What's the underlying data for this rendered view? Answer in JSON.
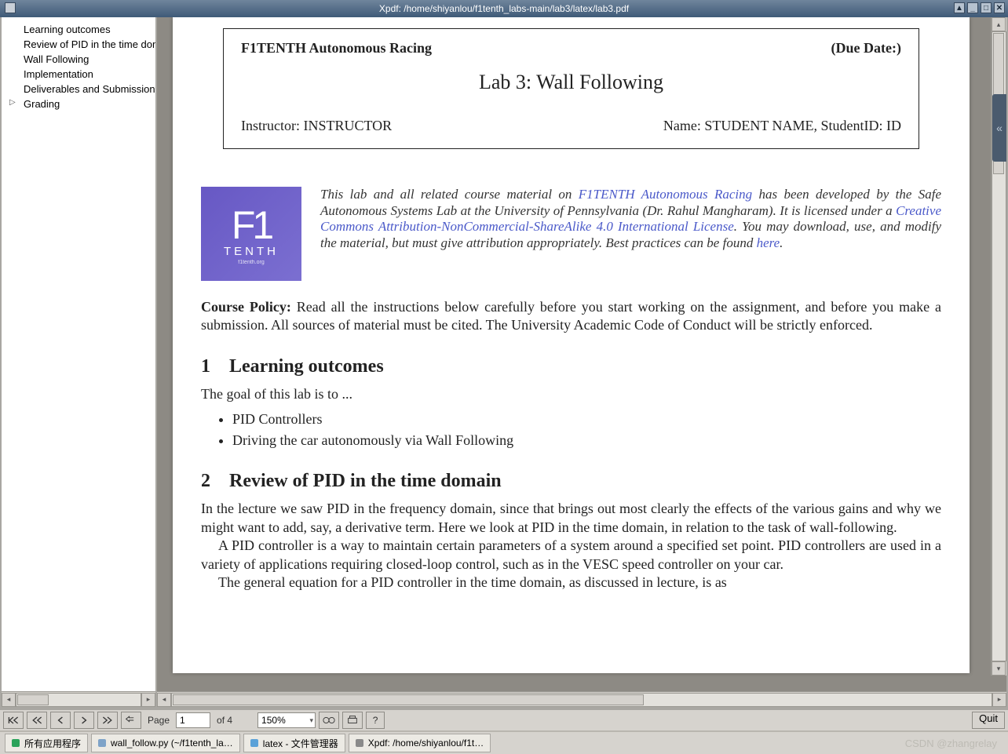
{
  "window": {
    "title": "Xpdf: /home/shiyanlou/f1tenth_labs-main/lab3/latex/lab3.pdf"
  },
  "outline": {
    "items": [
      {
        "label": "Learning outcomes",
        "arrow": false
      },
      {
        "label": "Review of PID in the time domain",
        "arrow": false
      },
      {
        "label": "Wall Following",
        "arrow": false
      },
      {
        "label": "Implementation",
        "arrow": false
      },
      {
        "label": "Deliverables and Submission",
        "arrow": false
      },
      {
        "label": "Grading",
        "arrow": true
      }
    ]
  },
  "doc": {
    "header_left": "F1TENTH Autonomous Racing",
    "header_right": "(Due Date:)",
    "title": "Lab 3: Wall Following",
    "instructor_label": "Instructor:",
    "instructor": "INSTRUCTOR",
    "name_label": "Name:",
    "name": "STUDENT NAME",
    "studentid_label": "StudentID:",
    "studentid": "ID",
    "logo_top": "F1",
    "logo_mid": "TENTH",
    "logo_sub": "f1tenth.org",
    "license_pre": "This lab and all related course material on ",
    "license_link1": "F1TENTH Autonomous Racing",
    "license_mid1": " has been developed by the Safe Autonomous Systems Lab at the University of Pennsylvania (Dr. Rahul Mangharam). It is licensed under a ",
    "license_link2": "Creative Commons Attribution-NonCommercial-ShareAlike 4.0 International License",
    "license_mid2": ". You may download, use, and modify the material, but must give attribution appropriately. Best practices can be found ",
    "license_here": "here",
    "license_end": ".",
    "policy_b": "Course Policy:",
    "policy": " Read all the instructions below carefully before you start working on the assignment, and before you make a submission. All sources of material must be cited. The University Academic Code of Conduct will be strictly enforced.",
    "sec1_num": "1",
    "sec1_title": "Learning outcomes",
    "sec1_body": "The goal of this lab is to ...",
    "sec1_bul1": "PID Controllers",
    "sec1_bul2": "Driving the car autonomously via Wall Following",
    "sec2_num": "2",
    "sec2_title": "Review of PID in the time domain",
    "sec2_p1": "In the lecture we saw PID in the frequency domain, since that brings out most clearly the effects of the various gains and why we might want to add, say, a derivative term. Here we look at PID in the time domain, in relation to the task of wall-following.",
    "sec2_p2": "A PID controller is a way to maintain certain parameters of a system around a specified set point. PID controllers are used in a variety of applications requiring closed-loop control, such as in the VESC speed controller on your car.",
    "sec2_p3": "The general equation for a PID controller in the time domain, as discussed in lecture, is as"
  },
  "toolbar": {
    "page_label": "Page",
    "page_current": "1",
    "page_of": "of 4",
    "zoom": "150%",
    "quit": "Quit"
  },
  "taskbar": {
    "apps": "所有应用程序",
    "items": [
      {
        "label": "wall_follow.py (~/f1tenth_la…",
        "icon": "#7ea3c8"
      },
      {
        "label": "latex - 文件管理器",
        "icon": "#5ba2d8"
      },
      {
        "label": "Xpdf: /home/shiyanlou/f1t…",
        "icon": "#8a8a8a"
      }
    ]
  },
  "watermark": "CSDN @zhangrelay"
}
